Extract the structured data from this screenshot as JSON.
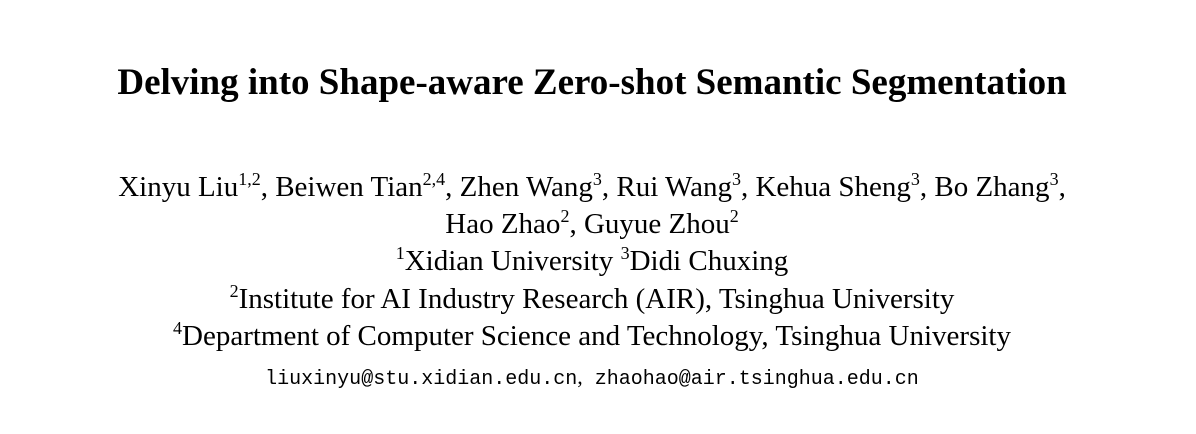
{
  "title": "Delving into Shape-aware Zero-shot Semantic Segmentation",
  "authors": [
    {
      "name": "Xinyu Liu",
      "sup": "1,2"
    },
    {
      "name": "Beiwen Tian",
      "sup": "2,4"
    },
    {
      "name": "Zhen Wang",
      "sup": "3"
    },
    {
      "name": "Rui Wang",
      "sup": "3"
    },
    {
      "name": "Kehua Sheng",
      "sup": "3"
    },
    {
      "name": "Bo Zhang",
      "sup": "3"
    },
    {
      "name": "Hao Zhao",
      "sup": "2"
    },
    {
      "name": "Guyue Zhou",
      "sup": "2"
    }
  ],
  "separator": ", ",
  "trailing_comma": ",",
  "affiliations": [
    {
      "sup": "1",
      "name": "Xidian University"
    },
    {
      "sup": "3",
      "name": "Didi Chuxing"
    },
    {
      "sup": "2",
      "name": "Institute for AI Industry Research (AIR), Tsinghua University"
    },
    {
      "sup": "4",
      "name": "Department of Computer Science and Technology, Tsinghua University"
    }
  ],
  "emails": [
    "liuxinyu@stu.xidian.edu.cn",
    "zhaohao@air.tsinghua.edu.cn"
  ],
  "email_separator": ","
}
